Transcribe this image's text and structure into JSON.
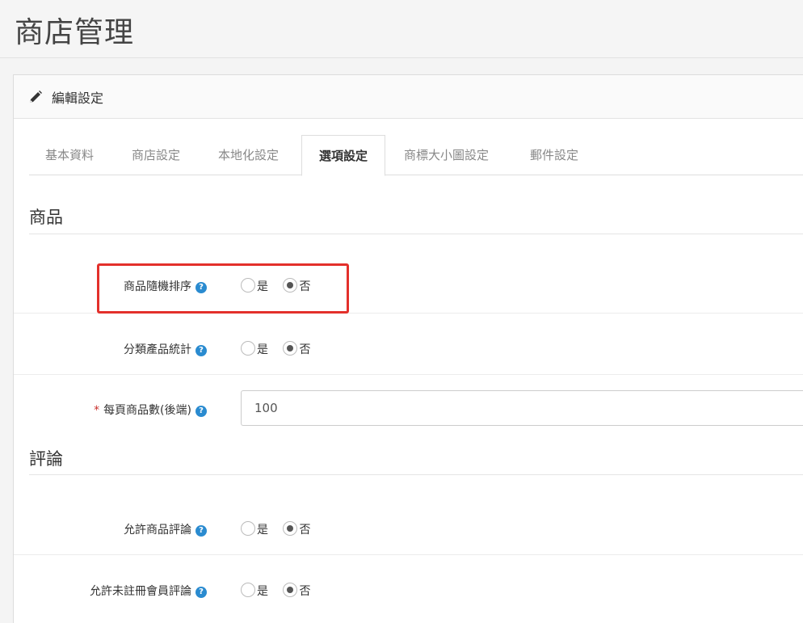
{
  "page": {
    "title": "商店管理"
  },
  "panel": {
    "title": "編輯設定",
    "icon": "pencil-icon"
  },
  "tabs": [
    {
      "label": "基本資料",
      "active": false
    },
    {
      "label": "商店設定",
      "active": false
    },
    {
      "label": "本地化設定",
      "active": false
    },
    {
      "label": "選項設定",
      "active": true
    },
    {
      "label": "商標大小圖設定",
      "active": false
    },
    {
      "label": "郵件設定",
      "active": false
    }
  ],
  "sections": {
    "product": {
      "title": "商品",
      "random_sort": {
        "label": "商品隨機排序",
        "yes": "是",
        "no": "否",
        "selected": "否"
      },
      "category_count": {
        "label": "分類產品統計",
        "yes": "是",
        "no": "否",
        "selected": "否"
      },
      "per_page": {
        "required_mark": "*",
        "label": "每頁商品數(後端)",
        "value": "100"
      }
    },
    "review": {
      "title": "評論",
      "allow_review": {
        "label": "允許商品評論",
        "yes": "是",
        "no": "否",
        "selected": "否"
      },
      "allow_guest_review": {
        "label": "允許未註冊會員評論",
        "yes": "是",
        "no": "否",
        "selected": "否"
      }
    }
  },
  "help_glyph": "?",
  "colors": {
    "accent_blue": "#2a8bd0",
    "highlight_red": "#e3302b",
    "required_red": "#c9302c"
  }
}
